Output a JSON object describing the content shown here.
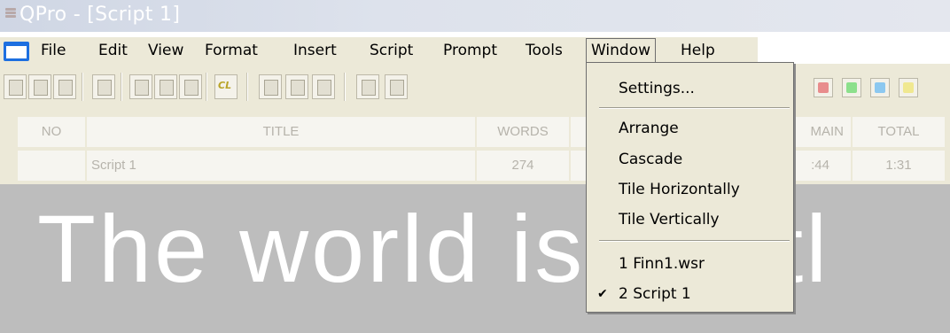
{
  "window": {
    "title": "QPro - [Script 1]"
  },
  "menubar": {
    "items": [
      "File",
      "Edit",
      "View",
      "Format",
      "Insert",
      "Script",
      "Prompt",
      "Tools",
      "Window",
      "Help"
    ],
    "active": "Window"
  },
  "toolbar": {
    "cl_label": "CL",
    "color_buttons": [
      "#e88c8c",
      "#8ce08c",
      "#8cc8f0",
      "#f0e890"
    ]
  },
  "table": {
    "headers": {
      "no": "NO",
      "title": "TITLE",
      "words": "WORDS",
      "remain": "MAIN",
      "total": "TOTAL"
    },
    "row": {
      "no": "",
      "title": "Script 1",
      "words": "274",
      "remain": ":44",
      "total": "1:31"
    }
  },
  "prompter": {
    "text": "The world is a littl"
  },
  "window_menu": {
    "settings": "Settings...",
    "arrange": "Arrange",
    "cascade": "Cascade",
    "tile_horizontally": "Tile Horizontally",
    "tile_vertically": "Tile Vertically",
    "doc1": "1 Finn1.wsr",
    "doc2": "2 Script 1",
    "checked": "2 Script 1"
  }
}
